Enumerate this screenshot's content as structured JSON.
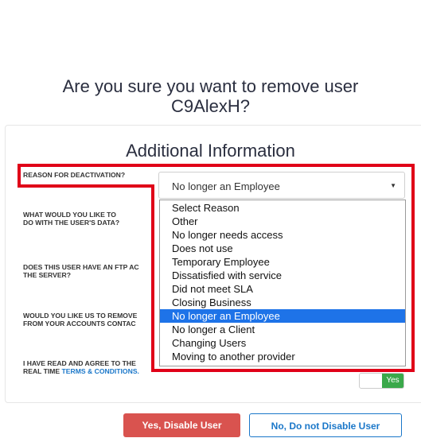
{
  "dialog": {
    "title_line1": "Are you sure you want to remove user",
    "title_line2": "C9AlexH?",
    "subtitle": "Additional Information"
  },
  "questions": {
    "reason": "REASON FOR DEACTIVATION?",
    "data_line1": "WHAT WOULD YOU LIKE TO",
    "data_line2": "DO WITH THE USER'S DATA?",
    "ftp_line1": "DOES THIS USER HAVE AN FTP AC",
    "ftp_line2": "THE SERVER?",
    "remove_line1": "WOULD YOU LIKE US TO REMOVE",
    "remove_line2": "FROM YOUR ACCOUNTS CONTAC",
    "terms_line1": "I HAVE READ AND AGREE TO THE",
    "terms_line2_prefix": "REAL TIME ",
    "terms_link": "TERMS & CONDITIONS."
  },
  "reason_select": {
    "selected": "No longer an Employee",
    "options": [
      "Select Reason",
      "Other",
      "No longer needs access",
      "Does not use",
      "Temporary Employee",
      "Dissatisfied with service",
      "Did not meet SLA",
      "Closing Business",
      "No longer an Employee",
      "No longer a Client",
      "Changing Users",
      "Moving to another provider"
    ]
  },
  "terms_toggle": {
    "label": "Yes",
    "state": "on"
  },
  "buttons": {
    "confirm": "Yes, Disable User",
    "cancel": "No, Do not Disable User"
  },
  "colors": {
    "highlight_border": "#e00018",
    "option_selected": "#1e73e8",
    "confirm_button": "#d9534f",
    "toggle_on": "#3aa84a",
    "link": "#1a77c9"
  }
}
